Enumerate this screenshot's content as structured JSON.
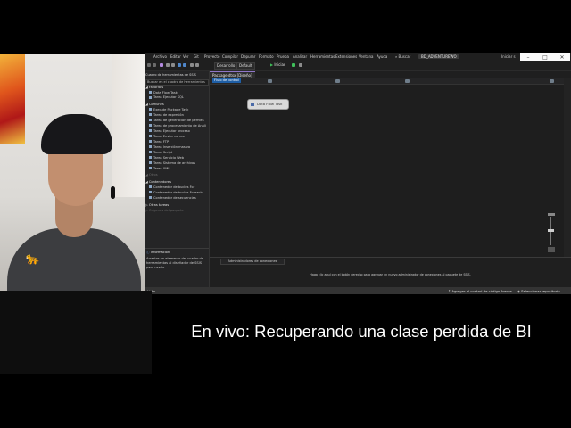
{
  "ide": {
    "menu": [
      "Archivo",
      "Editar",
      "Ver",
      "Git",
      "Proyecto",
      "Compilar",
      "Depurar",
      "Formato",
      "Prueba",
      "Analizar",
      "Herramientas",
      "Extensiones",
      "Ventana",
      "Ayuda"
    ],
    "search_label": "Buscar",
    "solution_name": "BD_ADVENTUREWO",
    "signin_label": "Iniciar s",
    "window_controls": {
      "minimize": "–",
      "maximize": "□",
      "close": "✕"
    },
    "toolbar": {
      "config_select": "Desarrollo",
      "platform_select": "Default",
      "start_label": "Iniciar"
    },
    "toolbox": {
      "title": "Cuadro de herramientas de SSIS",
      "search_placeholder": "Buscar en el cuadro de herramientas",
      "favorites_header": "Favoritos",
      "favorites": [
        "Data Flow Task",
        "Tarea Ejecutar SQL"
      ],
      "common_header": "Comunes",
      "common": [
        "Execute Package Task",
        "Tarea de expresión",
        "Tarea de generación de perfiles",
        "Tarea de procesamiento de Análi",
        "Tarea Ejecutar proceso",
        "Tarea Enviar correo",
        "Tarea FTP",
        "Tarea Inserción masiva",
        "Tarea Script",
        "Tarea Servicio Web",
        "Tarea Sistema de archivos",
        "Tarea XML"
      ],
      "other_header": "Otros",
      "containers_header": "Contenedores",
      "containers": [
        "Contenedor de bucles For",
        "Contenedor de bucles Foreach",
        "Contenedor de secuencias"
      ],
      "other_tasks_header": "Otras tareas",
      "other_sources_header": "Orígenes del paquete"
    },
    "info": {
      "title": "Información",
      "body": "Arrastre un elemento del cuadro de herramientas al diseñador de SSIS para usarlo."
    },
    "document_tab": "Package.dtsx [Diseño]",
    "control_flow_tab": "Flujo de control",
    "flow_task_label": "Data Flow Task",
    "connection_managers_tab": "Administradores de conexiones",
    "connection_hint": "Haga clic aquí con el botón derecho para agregar un nuevo administrador de conexiones al paquete de SSIS.",
    "status": {
      "ready": "Listo",
      "source_control": "Agregar al control de código fuente",
      "repository": "Seleccionar repositorio"
    }
  },
  "caption": "En vivo: Recuperando una clase perdida de BI"
}
